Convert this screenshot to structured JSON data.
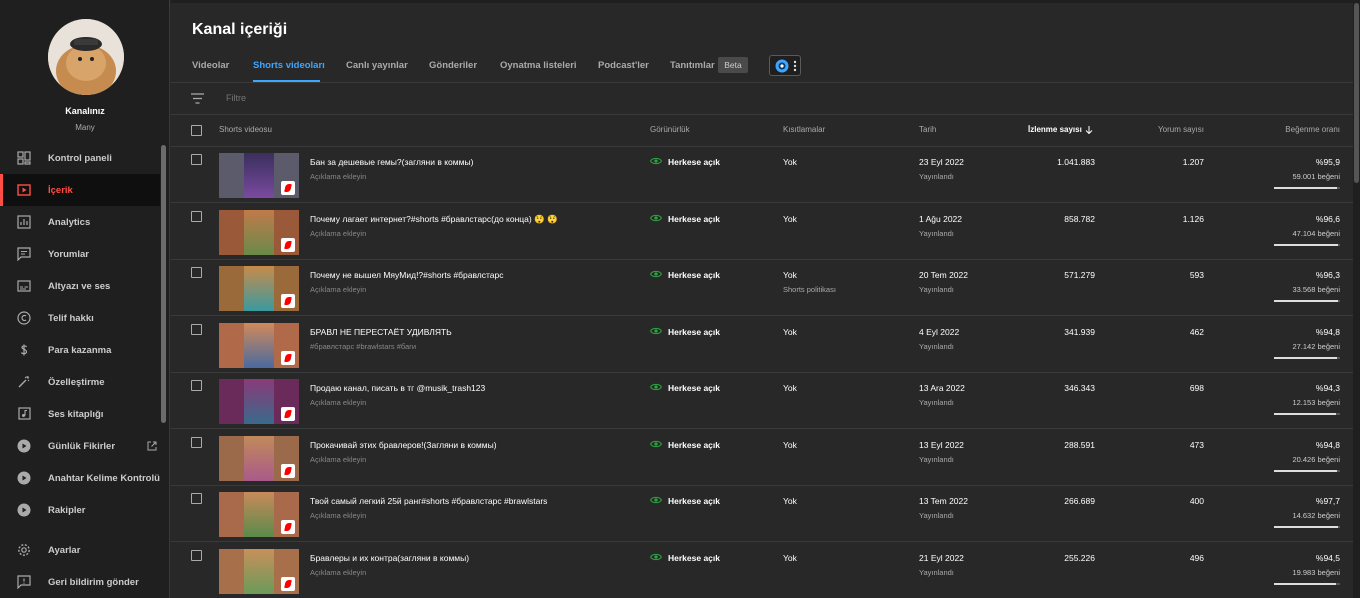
{
  "sidebar": {
    "channel_name": "Kanalınız",
    "channel_sub": "Many",
    "items": [
      {
        "label": "Kontrol paneli",
        "icon": "dashboard-icon"
      },
      {
        "label": "İçerik",
        "icon": "content-icon",
        "active": true
      },
      {
        "label": "Analytics",
        "icon": "analytics-icon"
      },
      {
        "label": "Yorumlar",
        "icon": "comments-icon"
      },
      {
        "label": "Altyazı ve ses",
        "icon": "subtitles-icon"
      },
      {
        "label": "Telif hakkı",
        "icon": "copyright-icon"
      },
      {
        "label": "Para kazanma",
        "icon": "dollar-icon"
      },
      {
        "label": "Özelleştirme",
        "icon": "magic-wand-icon"
      },
      {
        "label": "Ses kitaplığı",
        "icon": "audio-library-icon"
      },
      {
        "label": "Günlük Fikirler",
        "icon": "play-circle-icon",
        "external": true
      },
      {
        "label": "Anahtar Kelime Kontrolü",
        "icon": "play-circle-icon"
      },
      {
        "label": "Rakipler",
        "icon": "play-circle-icon"
      },
      {
        "label": "Ayarlar",
        "icon": "gear-icon"
      },
      {
        "label": "Geri bildirim gönder",
        "icon": "feedback-icon"
      }
    ]
  },
  "page_title": "Kanal içeriği",
  "tabs": [
    {
      "label": "Videolar"
    },
    {
      "label": "Shorts videoları",
      "active": true
    },
    {
      "label": "Canlı yayınlar"
    },
    {
      "label": "Gönderiler"
    },
    {
      "label": "Oynatma listeleri"
    },
    {
      "label": "Podcast'ler"
    },
    {
      "label": "Tanıtımlar"
    }
  ],
  "beta_label": "Beta",
  "filter": {
    "placeholder": "Filtre"
  },
  "columns": {
    "video": "Shorts videosu",
    "visibility": "Görünürlük",
    "restrictions": "Kısıtlamalar",
    "date": "Tarih",
    "views": "İzlenme sayısı",
    "comments": "Yorum sayısı",
    "like_ratio": "Beğenme oranı"
  },
  "rows": [
    {
      "title": "Бан за дешевые гемы?(загляни в коммы)",
      "desc": "Açıklama ekleyin",
      "visibility": "Herkese açık",
      "restriction": "Yok",
      "restriction_detail": "",
      "date": "23 Eyl 2022",
      "status": "Yayınlandı",
      "views": "1.041.883",
      "comments": "1.207",
      "like_ratio": "%95,9",
      "likes": "59.001 beğeni",
      "ratio_value": 0.959
    },
    {
      "title": "Почему лагает интернет?#shorts #бравлстарс(до конца) 😲 😲",
      "desc": "Açıklama ekleyin",
      "visibility": "Herkese açık",
      "restriction": "Yok",
      "restriction_detail": "",
      "date": "1 Ağu 2022",
      "status": "Yayınlandı",
      "views": "858.782",
      "comments": "1.126",
      "like_ratio": "%96,6",
      "likes": "47.104 beğeni",
      "ratio_value": 0.966
    },
    {
      "title": "Почему не вышел МяуМид!?#shorts #бравлстарс",
      "desc": "Açıklama ekleyin",
      "visibility": "Herkese açık",
      "restriction": "Yok",
      "restriction_detail": "Shorts politikası",
      "date": "20 Tem 2022",
      "status": "Yayınlandı",
      "views": "571.279",
      "comments": "593",
      "like_ratio": "%96,3",
      "likes": "33.568 beğeni",
      "ratio_value": 0.963
    },
    {
      "title": "БРАВЛ НЕ ПЕРЕСТАЁТ УДИВЛЯТЬ",
      "desc": "#бравлстарс #brawlstars #баги",
      "visibility": "Herkese açık",
      "restriction": "Yok",
      "restriction_detail": "",
      "date": "4 Eyl 2022",
      "status": "Yayınlandı",
      "views": "341.939",
      "comments": "462",
      "like_ratio": "%94,8",
      "likes": "27.142 beğeni",
      "ratio_value": 0.948
    },
    {
      "title": "Продаю канал, писать в тг @musik_trash123",
      "desc": "Açıklama ekleyin",
      "visibility": "Herkese açık",
      "restriction": "Yok",
      "restriction_detail": "",
      "date": "13 Ara 2022",
      "status": "Yayınlandı",
      "views": "346.343",
      "comments": "698",
      "like_ratio": "%94,3",
      "likes": "12.153 beğeni",
      "ratio_value": 0.943
    },
    {
      "title": "Прокачивай этих бравлеров!(Загляни в коммы)",
      "desc": "Açıklama ekleyin",
      "visibility": "Herkese açık",
      "restriction": "Yok",
      "restriction_detail": "",
      "date": "13 Eyl 2022",
      "status": "Yayınlandı",
      "views": "288.591",
      "comments": "473",
      "like_ratio": "%94,8",
      "likes": "20.426 beğeni",
      "ratio_value": 0.948
    },
    {
      "title": "Твой самый легкий 25й ранг#shorts #бравлстарс #brawlstars",
      "desc": "Açıklama ekleyin",
      "visibility": "Herkese açık",
      "restriction": "Yok",
      "restriction_detail": "",
      "date": "13 Tem 2022",
      "status": "Yayınlandı",
      "views": "266.689",
      "comments": "400",
      "like_ratio": "%97,7",
      "likes": "14.632 beğeni",
      "ratio_value": 0.977
    },
    {
      "title": "Бравлеры и их контра(загляни в коммы)",
      "desc": "Açıklama ekleyin",
      "visibility": "Herkese açık",
      "restriction": "Yok",
      "restriction_detail": "",
      "date": "21 Eyl 2022",
      "status": "Yayınlandı",
      "views": "255.226",
      "comments": "496",
      "like_ratio": "%94,5",
      "likes": "19.983 beğeni",
      "ratio_value": 0.945
    }
  ],
  "colors": {
    "accent": "#3ea6ff",
    "active_nav": "#ff4e45",
    "public_icon": "#2ba640"
  }
}
